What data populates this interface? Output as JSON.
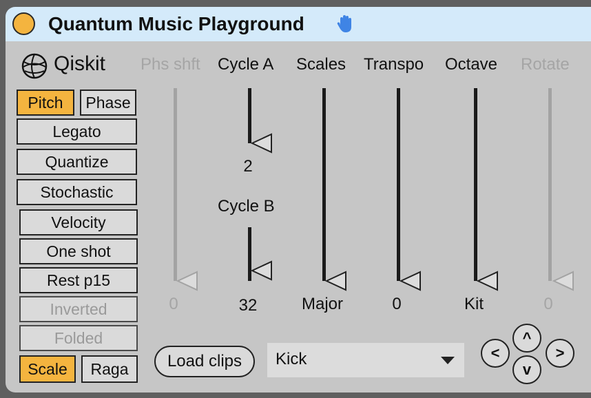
{
  "header": {
    "title": "Quantum Music Playground"
  },
  "logo": {
    "text": "Qiskit"
  },
  "columns": [
    {
      "label": "Phs shft",
      "enabled": false
    },
    {
      "label": "Cycle A",
      "enabled": true
    },
    {
      "label": "Scales",
      "enabled": true
    },
    {
      "label": "Transpo",
      "enabled": true
    },
    {
      "label": "Octave",
      "enabled": true
    },
    {
      "label": "Rotate",
      "enabled": false
    }
  ],
  "mode_buttons": {
    "pitch": "Pitch",
    "phase": "Phase",
    "scale": "Scale",
    "raga": "Raga"
  },
  "toggles": [
    {
      "label": "Legato",
      "enabled": true
    },
    {
      "label": "Quantize",
      "enabled": true
    },
    {
      "label": "Stochastic",
      "enabled": true
    },
    {
      "label": "Velocity",
      "enabled": true
    },
    {
      "label": "One shot",
      "enabled": true
    },
    {
      "label": "Rest p15",
      "enabled": true
    },
    {
      "label": "Inverted",
      "enabled": false
    },
    {
      "label": "Folded",
      "enabled": false
    }
  ],
  "sliders": {
    "phs_shft": {
      "value": "0"
    },
    "cycle_a": {
      "value": "2"
    },
    "cycle_b": {
      "label": "Cycle B",
      "value": "32"
    },
    "scales": {
      "value": "Major"
    },
    "transpo": {
      "value": "0"
    },
    "octave": {
      "value": "Kit"
    },
    "rotate": {
      "value": "0"
    }
  },
  "load_clips_label": "Load clips",
  "clip_select": {
    "selected": "Kick"
  },
  "nav": {
    "up": "^",
    "down": "v",
    "left": "<",
    "right": ">"
  },
  "colors": {
    "accent": "#f4b43f",
    "title_bg": "#d4eafa",
    "panel_bg": "#c6c6c6",
    "hand_icon": "#3f84e5"
  }
}
